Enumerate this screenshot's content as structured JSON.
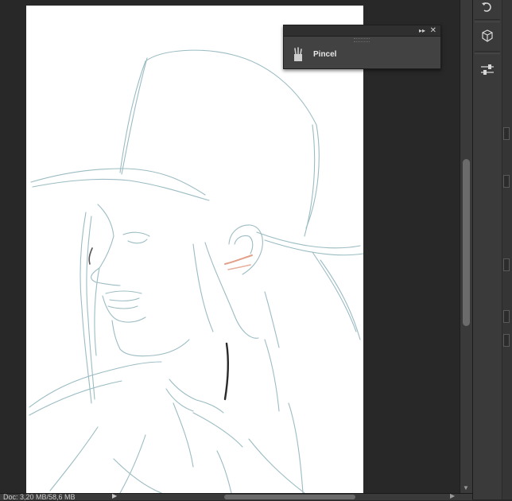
{
  "panel": {
    "title_collapse": "▸▸",
    "title_close": "✕",
    "tool_label": "Pincel",
    "tool_icon": "brush-presets-icon"
  },
  "status_bar": {
    "doc_info": "Doc: 3,20 MB/58,6 MB"
  },
  "dock": {
    "buttons": [
      "history-icon",
      "3d-icon",
      "adjust-sliders-icon"
    ]
  }
}
